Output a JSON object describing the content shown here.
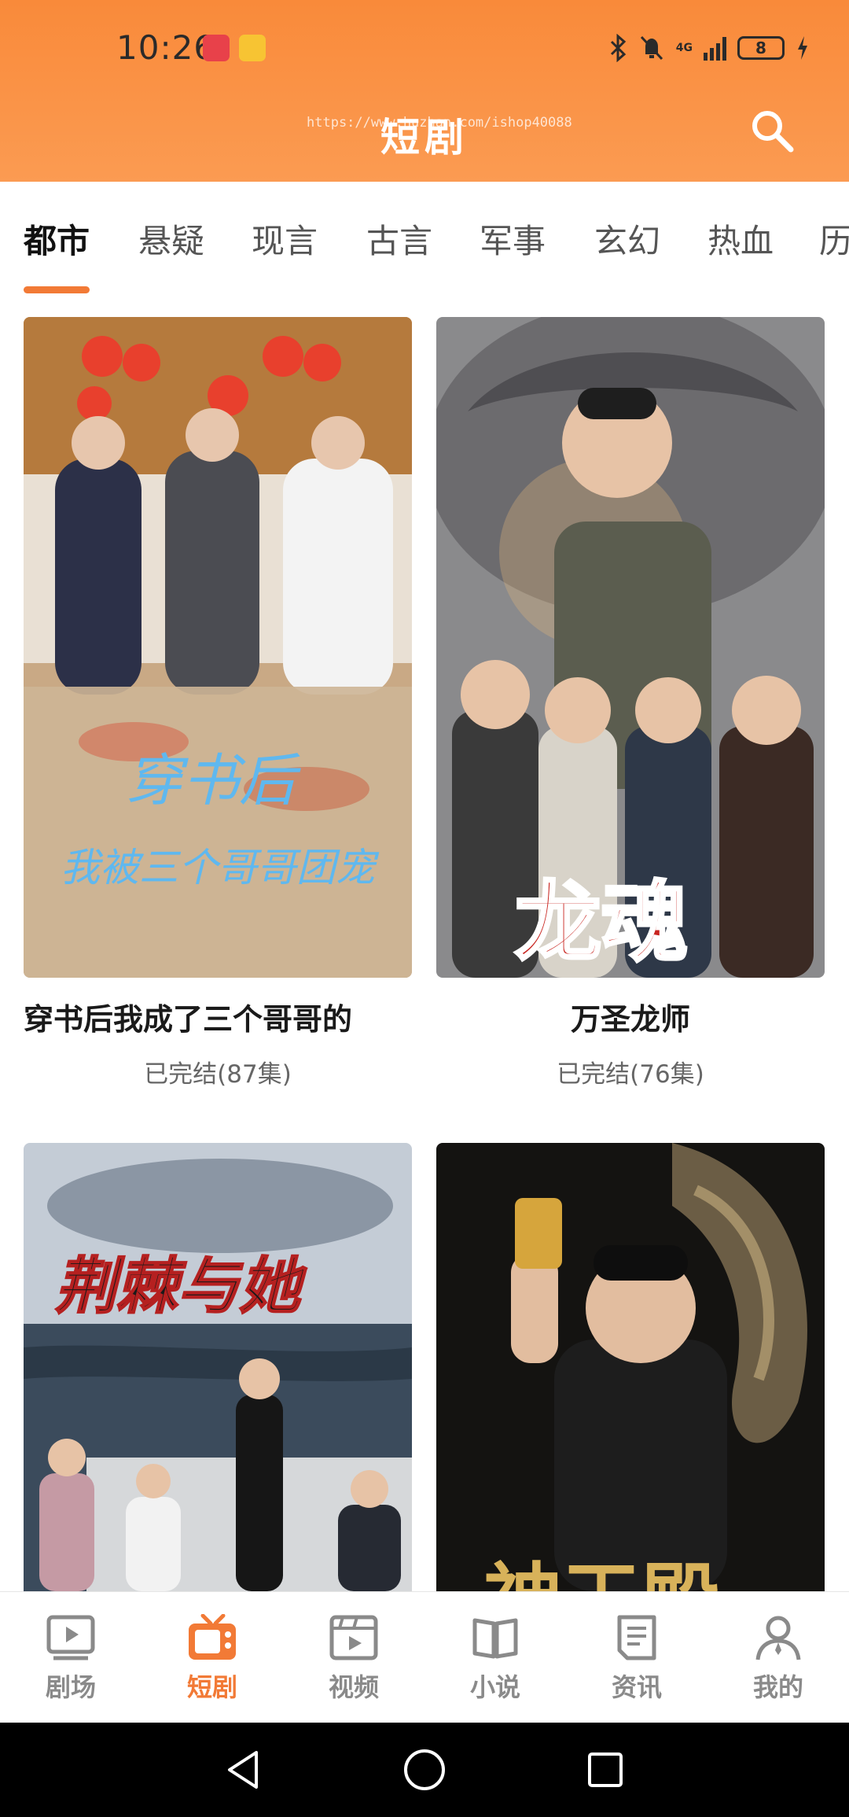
{
  "status_bar": {
    "time": "10:26",
    "network": "4G",
    "battery": "8"
  },
  "header": {
    "title": "短剧",
    "watermark": "https://www.huzhan.com/ishop40088"
  },
  "tabs": [
    "都市",
    "悬疑",
    "现言",
    "古言",
    "军事",
    "玄幻",
    "热血",
    "历"
  ],
  "active_tab": "都市",
  "cards": [
    {
      "title": "穿书后我成了三个哥哥的",
      "status": "已完结(87集)",
      "poster_text": [
        "穿书后",
        "我被三个哥哥团宠"
      ]
    },
    {
      "title": "万圣龙师",
      "status": "已完结(76集)",
      "poster_text": [
        "龙魂"
      ]
    },
    {
      "title": "",
      "status": "",
      "poster_text": [
        "荆棘与她"
      ]
    },
    {
      "title": "",
      "status": "",
      "poster_text": [
        "神王殿"
      ]
    }
  ],
  "bottom_nav": [
    {
      "label": "剧场",
      "icon": "theater-icon"
    },
    {
      "label": "短剧",
      "icon": "tv-icon"
    },
    {
      "label": "视频",
      "icon": "video-icon"
    },
    {
      "label": "小说",
      "icon": "book-icon"
    },
    {
      "label": "资讯",
      "icon": "news-icon"
    },
    {
      "label": "我的",
      "icon": "profile-icon"
    }
  ],
  "active_nav": "短剧",
  "colors": {
    "accent": "#f27a36",
    "header_top": "#f98a3a",
    "header_bottom": "#fb9b52",
    "nav_inactive": "#8a8a8a"
  }
}
